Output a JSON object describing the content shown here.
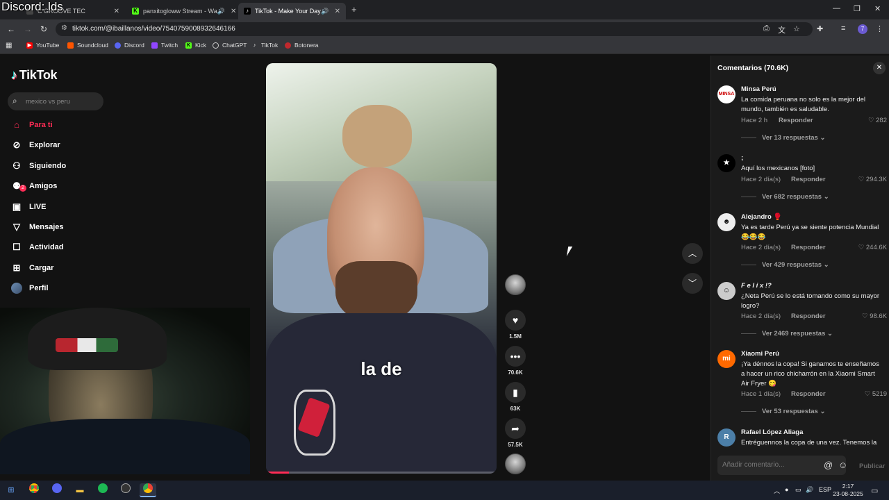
{
  "overlay_text": "Discord: lds",
  "browser": {
    "tabs": [
      {
        "title": "C GROOVE TEC",
        "active": false
      },
      {
        "title": "panxitogloww Stream - Wa",
        "active": false
      },
      {
        "title": "TikTok - Make Your Day",
        "active": true
      }
    ],
    "url": "tiktok.com/@ibaillanos/video/7540759008932646166",
    "profile_initial": "7",
    "bookmarks": [
      "YouTube",
      "Soundcloud",
      "Discord",
      "Twitch",
      "Kick",
      "ChatGPT",
      "TikTok",
      "Botonera"
    ]
  },
  "tiktok": {
    "logo": "TikTok",
    "search_placeholder": "mexico vs peru",
    "nav": [
      {
        "label": "Para ti",
        "icon": "home-icon",
        "active": true
      },
      {
        "label": "Explorar",
        "icon": "compass-icon"
      },
      {
        "label": "Siguiendo",
        "icon": "following-icon"
      },
      {
        "label": "Amigos",
        "icon": "friends-icon"
      },
      {
        "label": "LIVE",
        "icon": "live-icon"
      },
      {
        "label": "Mensajes",
        "icon": "messages-icon"
      },
      {
        "label": "Actividad",
        "icon": "activity-icon"
      },
      {
        "label": "Cargar",
        "icon": "upload-icon"
      },
      {
        "label": "Perfil",
        "icon": "profile-avatar"
      }
    ],
    "activity_badge": "2",
    "video": {
      "caption": "la de",
      "progress_fraction": 0.1
    },
    "actions": {
      "likes": "1.5M",
      "comments": "70.6K",
      "saves": "63K",
      "shares": "57.5K"
    },
    "comments_panel": {
      "title": "Comentarios (70.6K)",
      "input_placeholder": "Añadir comentario...",
      "post_label": "Publicar",
      "items": [
        {
          "user": "Minsa Perú",
          "text": "La comida peruana no solo es la mejor del mundo, también es saludable.",
          "time": "Hace 2 h",
          "reply": "Responder",
          "likes": "282",
          "more": "Ver 13 respuestas"
        },
        {
          "user": ";",
          "text": "Aquí los mexicanos [foto]",
          "time": "Hace 2 día(s)",
          "reply": "Responder",
          "likes": "294.3K",
          "more": "Ver 682 respuestas"
        },
        {
          "user": "Alejandro 🥊",
          "text": "Ya es tarde Perú ya se siente potencia Mundial 😂😂😂",
          "time": "Hace 2 día(s)",
          "reply": "Responder",
          "likes": "244.6K",
          "more": "Ver 429 respuestas"
        },
        {
          "user": "F e l i x !?",
          "text": "¿Neta Perú se lo está tomando como su mayor logro?",
          "time": "Hace 2 día(s)",
          "reply": "Responder",
          "likes": "98.6K",
          "more": "Ver 2469 respuestas"
        },
        {
          "user": "Xiaomi Perú",
          "text": "¡Ya dénnos la copa! Si ganamos te enseñamos a hacer un rico chicharrón en la Xiaomi Smart Air Fryer 😋",
          "time": "Hace 1 día(s)",
          "reply": "Responder",
          "likes": "5219",
          "more": "Ver 53 respuestas"
        },
        {
          "user": "Rafael López Aliaga",
          "text": "Entréguennos la copa de una vez. Tenemos la"
        }
      ]
    }
  },
  "taskbar": {
    "lang": "ESP",
    "time": "2:17",
    "date": "23-08-2025"
  }
}
